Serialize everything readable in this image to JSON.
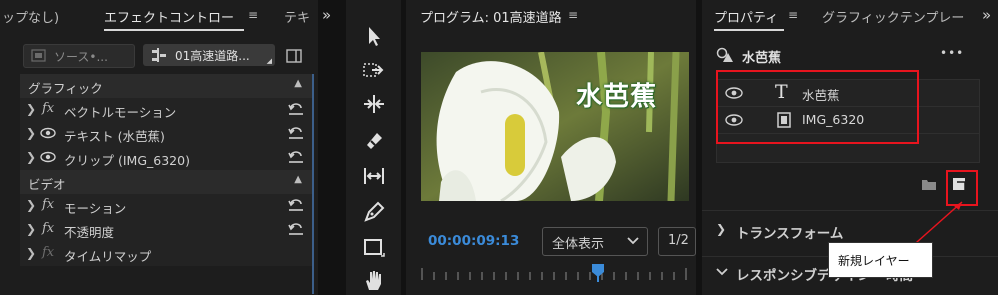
{
  "effects_panel": {
    "tabs": [
      "ップなし)",
      "エフェクトコントロー",
      "テキ"
    ],
    "menu_glyph": "≡",
    "overflow_glyph": "»",
    "source_label": "ソース•...",
    "clip_label": "01高速道路...",
    "sections": [
      {
        "label": "グラフィック",
        "items": [
          {
            "label": "ベクトルモーション",
            "icon": "fx"
          },
          {
            "label": "テキスト (水芭蕉)",
            "icon": "eye"
          },
          {
            "label": "クリップ (IMG_6320)",
            "icon": "eye"
          }
        ]
      },
      {
        "label": "ビデオ",
        "items": [
          {
            "label": "モーション",
            "icon": "fx"
          },
          {
            "label": "不透明度",
            "icon": "fx"
          },
          {
            "label": "タイムリマップ",
            "icon": "fx-dim"
          }
        ]
      }
    ]
  },
  "tools": [
    "selection-tool",
    "track-select-forward-tool",
    "ripple-edit-tool",
    "razor-tool",
    "slip-tool",
    "pen-tool",
    "rectangle-tool",
    "hand-tool"
  ],
  "program": {
    "title": "プログラム: 01高速道路",
    "menu_glyph": "≡",
    "video_title": "水芭蕉",
    "timecode": "00:00:09:13",
    "zoom": "全体表示",
    "resolution": "1/2"
  },
  "properties": {
    "tabs": [
      "プロパティ",
      "グラフィックテンプレー"
    ],
    "menu_glyph": "≡",
    "overflow_glyph": "»",
    "graphic_name": "水芭蕉",
    "more_glyph": "•••",
    "layers": [
      {
        "name": "水芭蕉",
        "type": "text"
      },
      {
        "name": "IMG_6320",
        "type": "clip"
      }
    ],
    "sections": [
      "トランスフォーム",
      "レスポンシブデザイン - 時間"
    ],
    "tooltip": "新規レイヤー"
  },
  "colors": {
    "accent_blue": "#3b8bd9",
    "highlight_red": "#e8141e",
    "panel_bg": "#1d1d1d"
  }
}
